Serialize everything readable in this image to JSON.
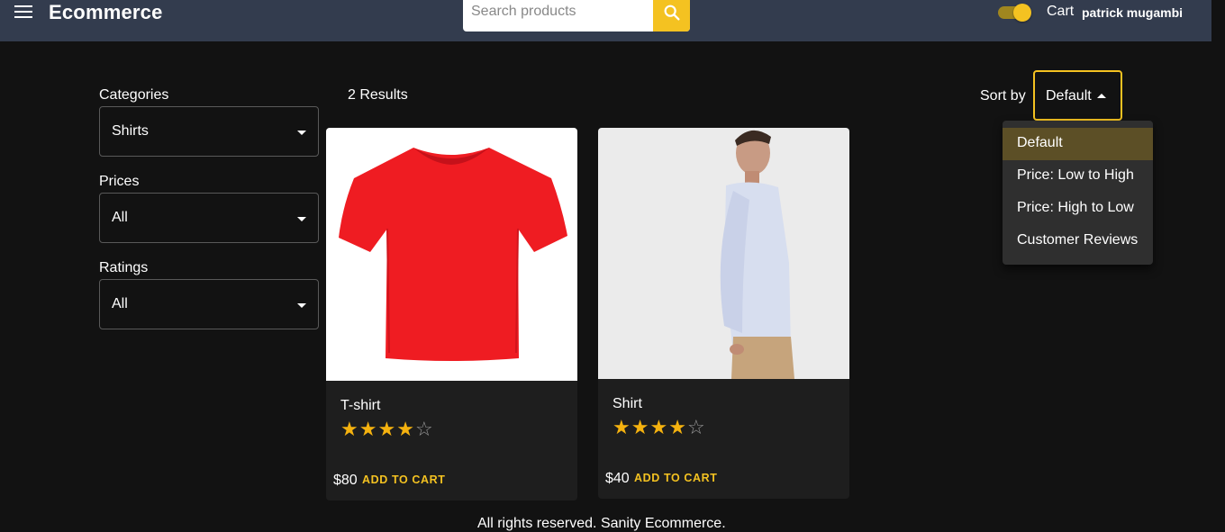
{
  "header": {
    "brand": "Ecommerce",
    "search_placeholder": "Search products",
    "cart_label": "Cart",
    "user_name": "patrick mugambi",
    "dark_mode_on": true
  },
  "filters": [
    {
      "label": "Categories",
      "value": "Shirts"
    },
    {
      "label": "Prices",
      "value": "All"
    },
    {
      "label": "Ratings",
      "value": "All"
    }
  ],
  "results_text": "2 Results",
  "sort": {
    "label": "Sort by",
    "value": "Default",
    "options": [
      "Default",
      "Price: Low to High",
      "Price: High to Low",
      "Customer Reviews"
    ],
    "selected_index": 0
  },
  "products": [
    {
      "name": "T-shirt",
      "price": "$80",
      "rating": 4,
      "max_rating": 5,
      "action": "ADD TO CART"
    },
    {
      "name": "Shirt",
      "price": "$40",
      "rating": 4,
      "max_rating": 5,
      "action": "ADD TO CART"
    }
  ],
  "footer": "All rights reserved. Sanity Ecommerce.",
  "colors": {
    "accent": "#f4c221",
    "appbar": "#333c4e",
    "background": "#121212",
    "card": "#1e1e1e",
    "star": "#f5b20f"
  }
}
